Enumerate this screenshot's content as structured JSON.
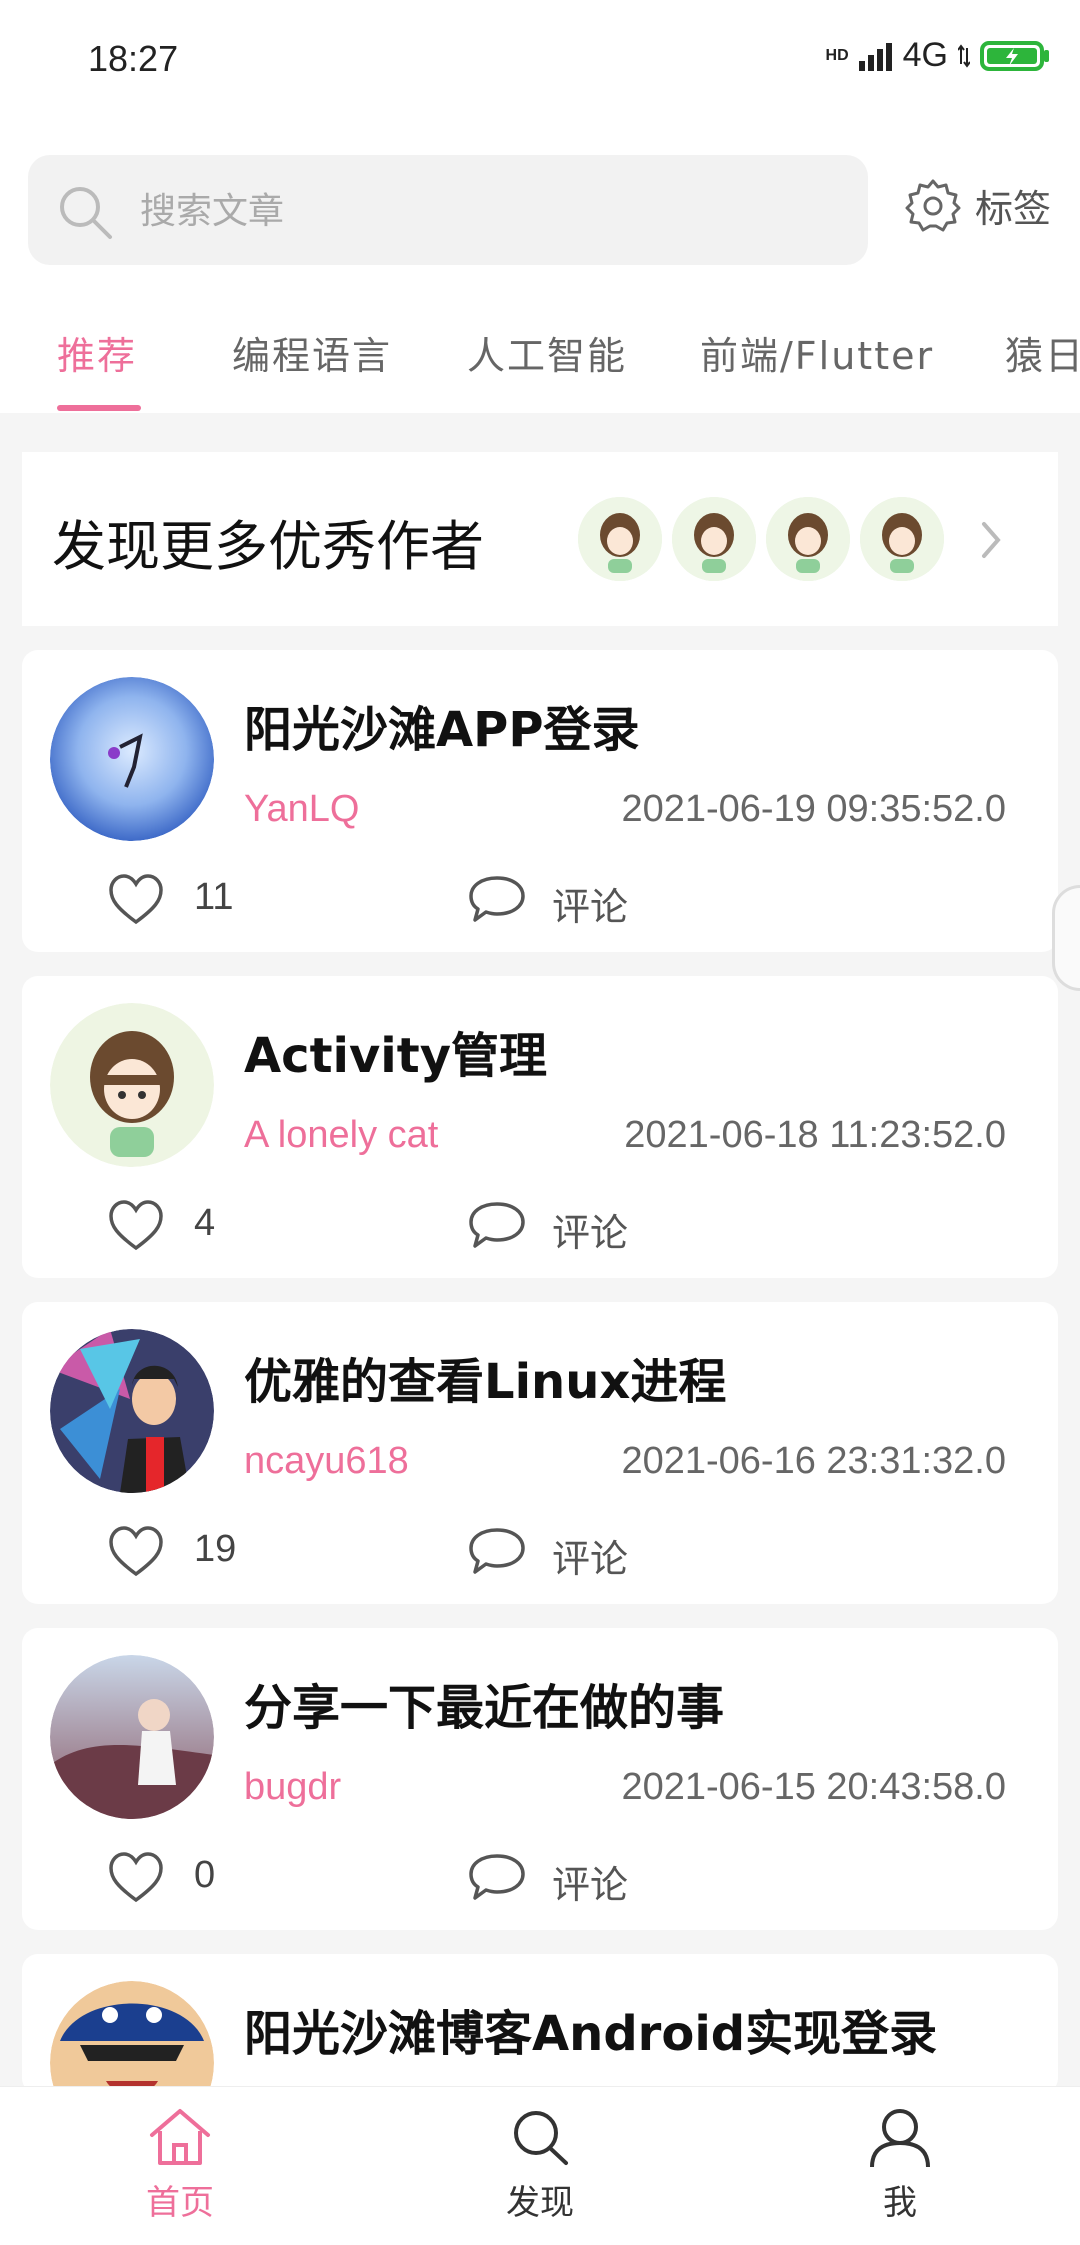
{
  "status": {
    "time": "18:27",
    "network": "4G",
    "hd": "HD"
  },
  "search": {
    "placeholder": "搜索文章"
  },
  "tags_label": "标签",
  "tabs": [
    {
      "label": "推荐",
      "active": true
    },
    {
      "label": "编程语言"
    },
    {
      "label": "人工智能"
    },
    {
      "label": "前端/Flutter"
    },
    {
      "label": "猿日"
    }
  ],
  "authors_banner": {
    "title": "发现更多优秀作者"
  },
  "posts": [
    {
      "title": "阳光沙滩APP登录",
      "author": "YanLQ",
      "date": "2021-06-19 09:35:52.0",
      "likes": "11",
      "comment_label": "评论"
    },
    {
      "title": "Activity管理",
      "author": "A lonely cat",
      "date": "2021-06-18 11:23:52.0",
      "likes": "4",
      "comment_label": "评论"
    },
    {
      "title": "优雅的查看Linux进程",
      "author": "ncayu618",
      "date": "2021-06-16 23:31:32.0",
      "likes": "19",
      "comment_label": "评论"
    },
    {
      "title": "分享一下最近在做的事",
      "author": "bugdr",
      "date": "2021-06-15 20:43:58.0",
      "likes": "0",
      "comment_label": "评论"
    },
    {
      "title": "阳光沙滩博客Android实现登录"
    }
  ],
  "bottom_nav": [
    {
      "label": "首页",
      "active": true,
      "icon": "home-icon"
    },
    {
      "label": "发现",
      "icon": "search-icon"
    },
    {
      "label": "我",
      "icon": "person-icon"
    }
  ],
  "colors": {
    "accent": "#ee6f9a",
    "background": "#f5f5f5"
  }
}
